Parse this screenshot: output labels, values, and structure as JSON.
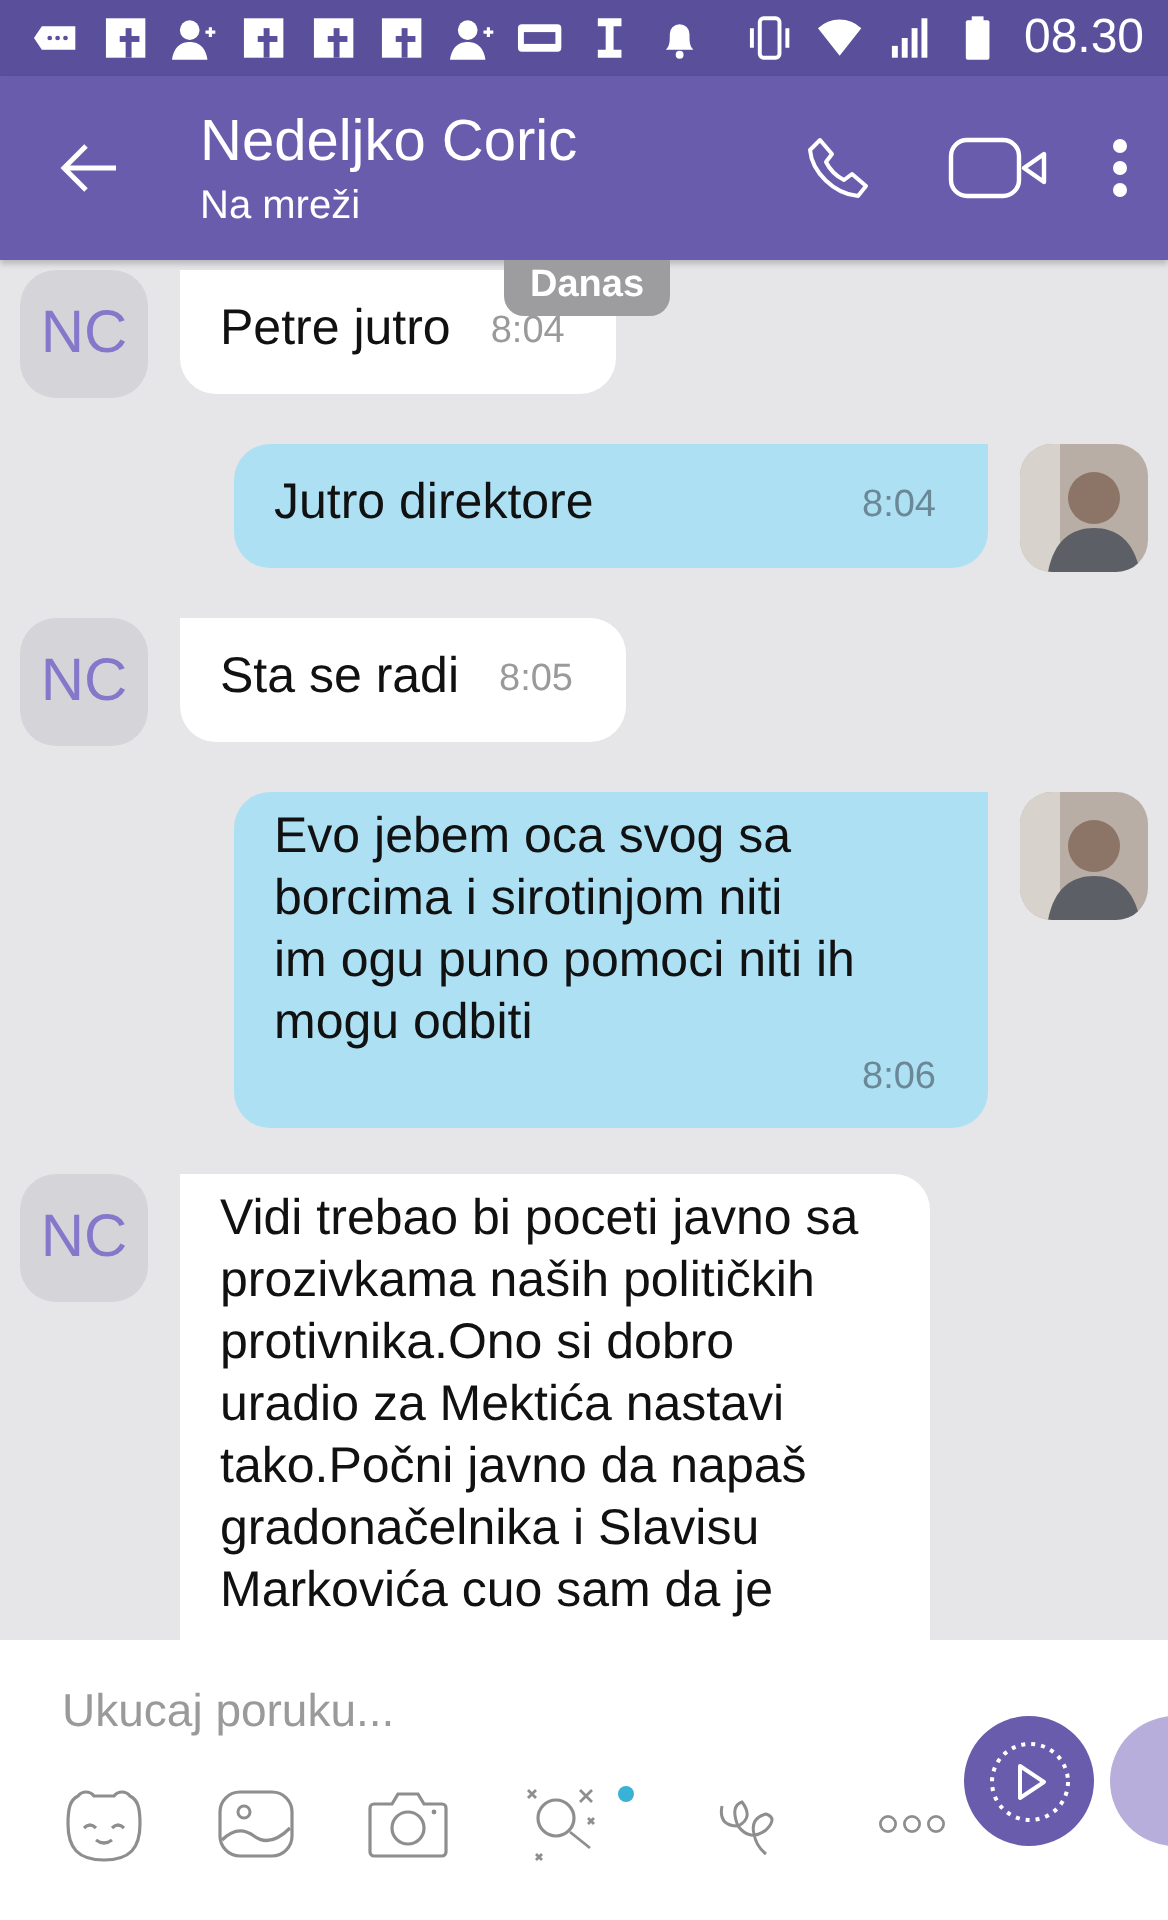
{
  "status_bar": {
    "time": "08.30"
  },
  "header": {
    "title": "Nedeljko Coric",
    "subtitle": "Na mreži"
  },
  "date_chip": "Danas",
  "messages": [
    {
      "kind": "incoming",
      "avatar": "NC",
      "text": "Petre jutro",
      "time": "8:04"
    },
    {
      "kind": "outgoing",
      "text": "Jutro direktore",
      "time": "8:04"
    },
    {
      "kind": "incoming",
      "avatar": "NC",
      "text": "Sta se radi",
      "time": "8:05"
    },
    {
      "kind": "outgoing",
      "text": "Evo jebem oca svog sa borcima i sirotinjom niti\nim ogu puno pomoci niti ih mogu odbiti",
      "time": "8:06"
    },
    {
      "kind": "incoming",
      "avatar": "NC",
      "text": "Vidi trebao bi poceti javno sa prozivkama naših političkih protivnika.Ono si dobro uradio za Mektića nastavi tako.Počni javno da napaš gradonačelnika i Slavisu Markovića cuo sam da je"
    }
  ],
  "composer": {
    "placeholder": "Ukucaj poruku..."
  }
}
